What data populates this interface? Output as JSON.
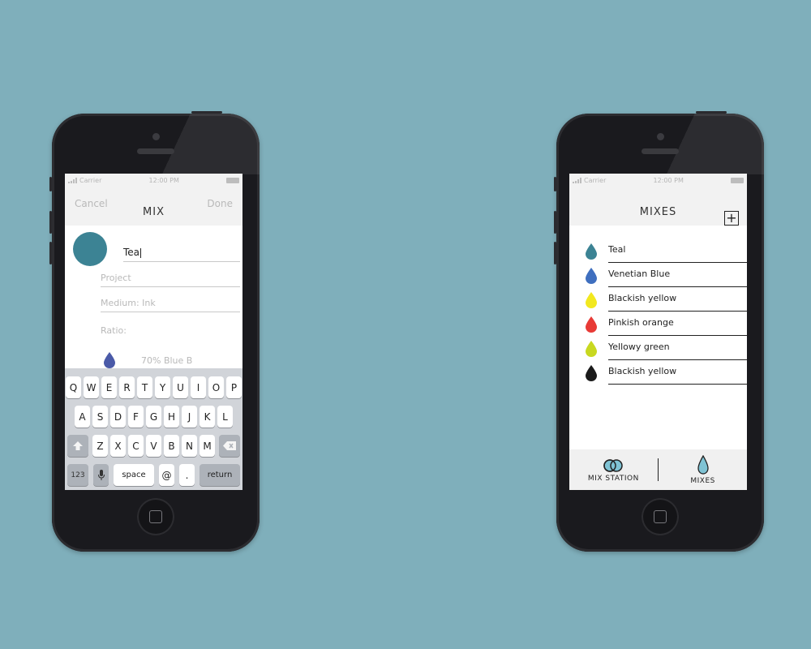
{
  "left_phone": {
    "status": {
      "carrier": "Carrier",
      "time": "12:00 PM"
    },
    "nav": {
      "cancel": "Cancel",
      "title": "MIX",
      "done": "Done"
    },
    "form": {
      "name_value": "Tea",
      "project_placeholder": "Project",
      "medium_placeholder": "Medium: Ink",
      "ratio_label": "Ratio:",
      "ratio_item": "70% Blue B",
      "swatch_color": "#3c8394",
      "ratio_drop_color": "#4a5aa8"
    },
    "keyboard": {
      "row1": [
        "Q",
        "W",
        "E",
        "R",
        "T",
        "Y",
        "U",
        "I",
        "O",
        "P"
      ],
      "row2": [
        "A",
        "S",
        "D",
        "F",
        "G",
        "H",
        "J",
        "K",
        "L"
      ],
      "row3": [
        "Z",
        "X",
        "C",
        "V",
        "B",
        "N",
        "M"
      ],
      "row4": {
        "num": "123",
        "space": "space",
        "at": "@",
        "dot": ".",
        "return": "return"
      }
    }
  },
  "right_phone": {
    "status": {
      "carrier": "Carrier",
      "time": "12:00 PM"
    },
    "nav": {
      "title": "MIXES",
      "add": "+"
    },
    "mixes": [
      {
        "name": "Teal",
        "color": "#3c8394"
      },
      {
        "name": "Venetian Blue",
        "color": "#3f6fbf"
      },
      {
        "name": "Blackish yellow",
        "color": "#f2e81f"
      },
      {
        "name": "Pinkish orange",
        "color": "#e83a36"
      },
      {
        "name": "Yellowy green",
        "color": "#c8d820"
      },
      {
        "name": "Blackish yellow",
        "color": "#1a1a1a"
      }
    ],
    "tabs": [
      {
        "label": "MIX STATION",
        "icon": "mix-station-icon"
      },
      {
        "label": "MIXES",
        "icon": "drop-icon"
      }
    ]
  },
  "colors": {
    "background": "#7fafbb",
    "accent_teal": "#3c8394"
  }
}
